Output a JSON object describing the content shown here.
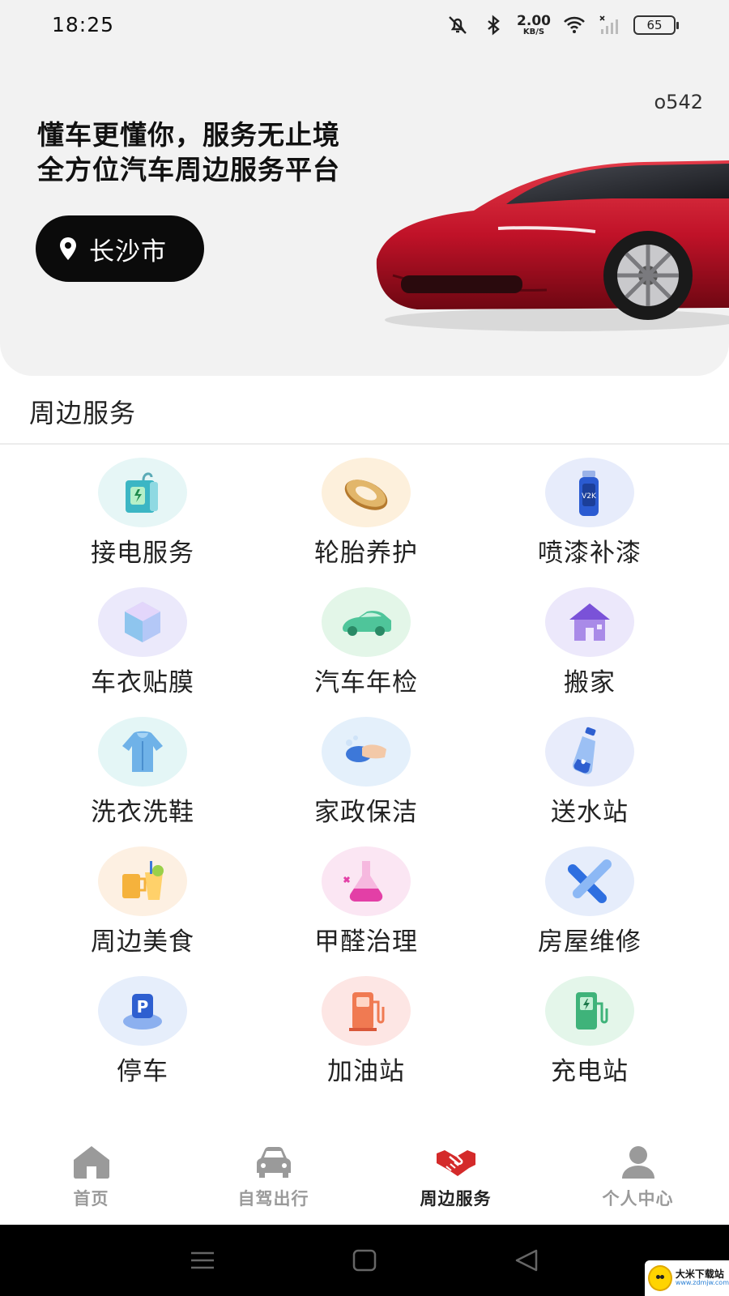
{
  "status_bar": {
    "time": "18:25",
    "net_speed_value": "2.00",
    "net_speed_unit": "KB/S",
    "battery": "65",
    "icons": [
      "mute-icon",
      "bluetooth-icon",
      "wifi-icon",
      "signal-icon"
    ]
  },
  "hero": {
    "code": "o542",
    "headline_line1": "懂车更懂你，服务无止境",
    "headline_line2": "全方位汽车周边服务平台",
    "city": "长沙市",
    "accent_color": "#c8102e"
  },
  "section": {
    "title": "周边服务"
  },
  "services": [
    {
      "label": "接电服务",
      "icon": "power-station-icon",
      "bg": "#e6f6f6"
    },
    {
      "label": "轮胎养护",
      "icon": "tire-icon",
      "bg": "#fdf0dc"
    },
    {
      "label": "喷漆补漆",
      "icon": "spray-can-icon",
      "bg": "#e7ecfb"
    },
    {
      "label": "车衣贴膜",
      "icon": "film-cube-icon",
      "bg": "#ebe9fb"
    },
    {
      "label": "汽车年检",
      "icon": "car-inspection-icon",
      "bg": "#e3f6e8"
    },
    {
      "label": "搬家",
      "icon": "house-icon",
      "bg": "#ece8fb"
    },
    {
      "label": "洗衣洗鞋",
      "icon": "hoodie-icon",
      "bg": "#e4f6f6"
    },
    {
      "label": "家政保洁",
      "icon": "cleaning-glove-icon",
      "bg": "#e4f0fb"
    },
    {
      "label": "送水站",
      "icon": "water-bottle-icon",
      "bg": "#e8ecfb"
    },
    {
      "label": "周边美食",
      "icon": "drinks-icon",
      "bg": "#fdf0e2"
    },
    {
      "label": "甲醛治理",
      "icon": "flask-icon",
      "bg": "#fbe6f3"
    },
    {
      "label": "房屋维修",
      "icon": "tools-icon",
      "bg": "#e6edfb"
    },
    {
      "label": "停车",
      "icon": "parking-icon",
      "bg": "#e6eefb"
    },
    {
      "label": "加油站",
      "icon": "fuel-pump-icon",
      "bg": "#fde6e4"
    },
    {
      "label": "充电站",
      "icon": "charging-station-icon",
      "bg": "#e4f6ea"
    }
  ],
  "tabs": [
    {
      "label": "首页",
      "icon": "home-icon",
      "active": false
    },
    {
      "label": "自驾出行",
      "icon": "car-icon",
      "active": false
    },
    {
      "label": "周边服务",
      "icon": "handshake-icon",
      "active": true
    },
    {
      "label": "个人中心",
      "icon": "person-icon",
      "active": false
    }
  ],
  "watermark": {
    "line1": "大米下载站",
    "line2": "www.zdmjw.com"
  }
}
